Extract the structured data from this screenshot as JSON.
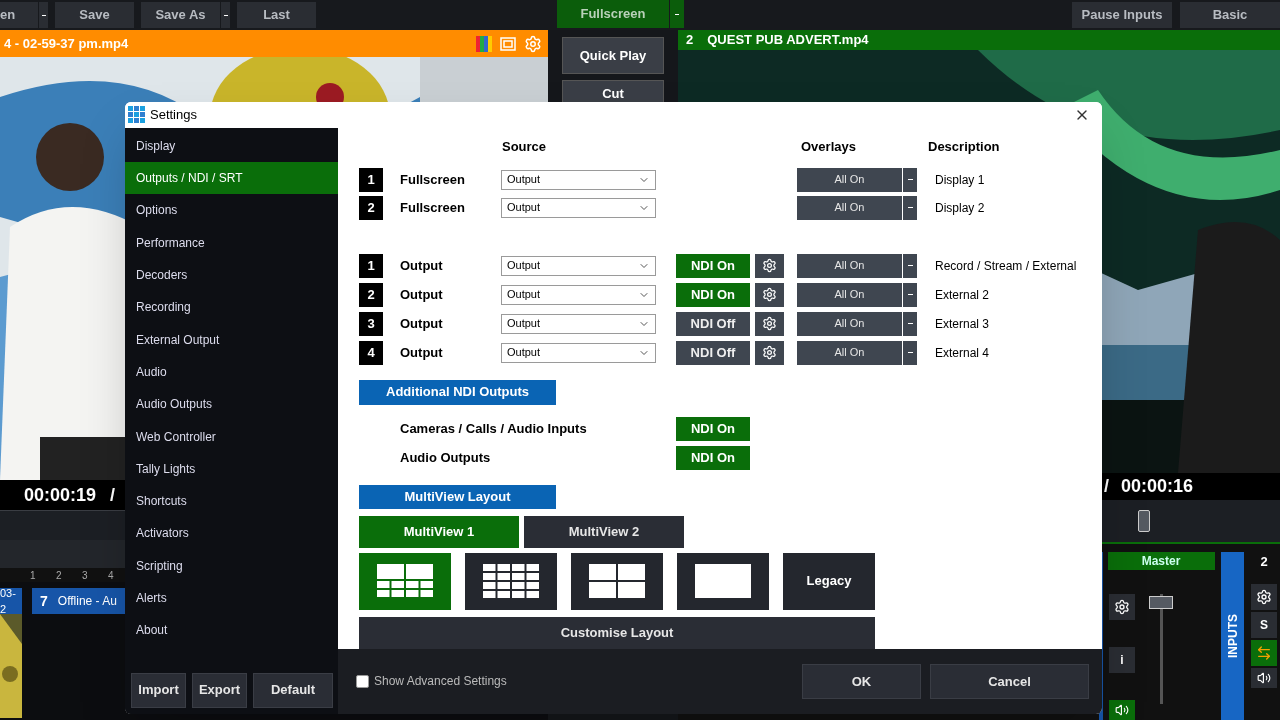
{
  "toolbar": {
    "left_buttons": [
      {
        "label": "en",
        "caret": true
      },
      {
        "label": "Save",
        "caret": false
      },
      {
        "label": "Save As",
        "caret": true
      },
      {
        "label": "Last",
        "caret": false
      }
    ],
    "center_button": "Fullscreen",
    "right_buttons": [
      "Pause Inputs",
      "Basic"
    ]
  },
  "preview": {
    "title": "4 - 02-59-37 pm.mp4",
    "time": "00:00:19",
    "separator": "/"
  },
  "transition_buttons": [
    "Quick Play",
    "Cut"
  ],
  "program": {
    "number": "2",
    "title": "QUEST PUB ADVERT.mp4",
    "separator": "/",
    "time": "00:00:16"
  },
  "input_tabs": [
    "1",
    "2",
    "3",
    "4"
  ],
  "inputs": [
    {
      "label": "03-2"
    },
    {
      "number": "7",
      "label": "Offline - Au"
    }
  ],
  "audio": {
    "master": "Master",
    "inputs_label": "INPUTS",
    "input_number": "2",
    "solo": "S",
    "info": "i"
  },
  "settings": {
    "title": "Settings",
    "nav": [
      {
        "label": "Display",
        "selected": false
      },
      {
        "label": "Outputs / NDI / SRT",
        "selected": true
      },
      {
        "label": "Options",
        "selected": false
      },
      {
        "label": "Performance",
        "selected": false
      },
      {
        "label": "Decoders",
        "selected": false
      },
      {
        "label": "Recording",
        "selected": false
      },
      {
        "label": "External Output",
        "selected": false
      },
      {
        "label": "Audio",
        "selected": false
      },
      {
        "label": "Audio Outputs",
        "selected": false
      },
      {
        "label": "Web Controller",
        "selected": false
      },
      {
        "label": "Tally Lights",
        "selected": false
      },
      {
        "label": "Shortcuts",
        "selected": false
      },
      {
        "label": "Activators",
        "selected": false
      },
      {
        "label": "Scripting",
        "selected": false
      },
      {
        "label": "Alerts",
        "selected": false
      },
      {
        "label": "About",
        "selected": false
      }
    ],
    "nav_buttons": [
      "Import",
      "Export",
      "Default"
    ],
    "columns": {
      "source": "Source",
      "overlays": "Overlays",
      "description": "Description"
    },
    "displays": [
      {
        "number": "1",
        "name": "Fullscreen",
        "source": "Output",
        "overlays": "All On",
        "description": "Display 1"
      },
      {
        "number": "2",
        "name": "Fullscreen",
        "source": "Output",
        "overlays": "All On",
        "description": "Display 2"
      }
    ],
    "outputs": [
      {
        "number": "1",
        "name": "Output",
        "source": "Output",
        "ndi_label": "NDI On",
        "ndi_on": true,
        "overlays": "All On",
        "description": "Record / Stream / External"
      },
      {
        "number": "2",
        "name": "Output",
        "source": "Output",
        "ndi_label": "NDI On",
        "ndi_on": true,
        "overlays": "All On",
        "description": "External 2"
      },
      {
        "number": "3",
        "name": "Output",
        "source": "Output",
        "ndi_label": "NDI Off",
        "ndi_on": false,
        "overlays": "All On",
        "description": "External 3"
      },
      {
        "number": "4",
        "name": "Output",
        "source": "Output",
        "ndi_label": "NDI Off",
        "ndi_on": false,
        "overlays": "All On",
        "description": "External 4"
      }
    ],
    "additional_ndi": {
      "heading": "Additional NDI Outputs",
      "rows": [
        {
          "label": "Cameras / Calls / Audio Inputs",
          "ndi_label": "NDI On",
          "ndi_on": true
        },
        {
          "label": "Audio Outputs",
          "ndi_label": "NDI On",
          "ndi_on": true
        }
      ]
    },
    "multiview": {
      "heading": "MultiView Layout",
      "tabs": [
        {
          "label": "MultiView 1",
          "selected": true
        },
        {
          "label": "MultiView 2",
          "selected": false
        }
      ],
      "layouts": [
        {
          "kind": "two-plus-eight",
          "selected": true
        },
        {
          "kind": "sixteen",
          "selected": false
        },
        {
          "kind": "quad",
          "selected": false
        },
        {
          "kind": "single",
          "selected": false
        },
        {
          "kind": "text",
          "label": "Legacy",
          "selected": false
        }
      ],
      "customise": "Customise Layout"
    },
    "advanced": {
      "label": "Show Advanced Settings",
      "checked": false
    },
    "footer_buttons": [
      "OK",
      "Cancel"
    ]
  }
}
